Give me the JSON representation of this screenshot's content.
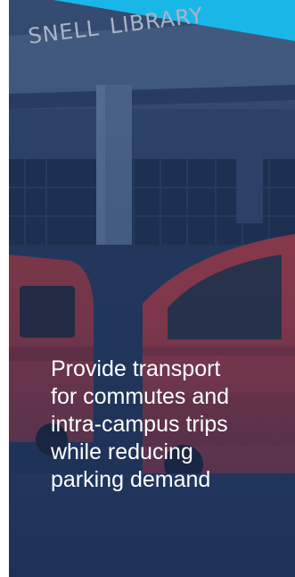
{
  "background": {
    "sign_words": [
      "SNELL",
      "LIBRARY"
    ],
    "accent_color": "#19b7e8",
    "overlay_color": "#1d3566"
  },
  "caption": {
    "lines": [
      "Provide transport",
      "for commutes and",
      "intra-campus trips",
      "while reducing",
      "parking demand"
    ]
  }
}
